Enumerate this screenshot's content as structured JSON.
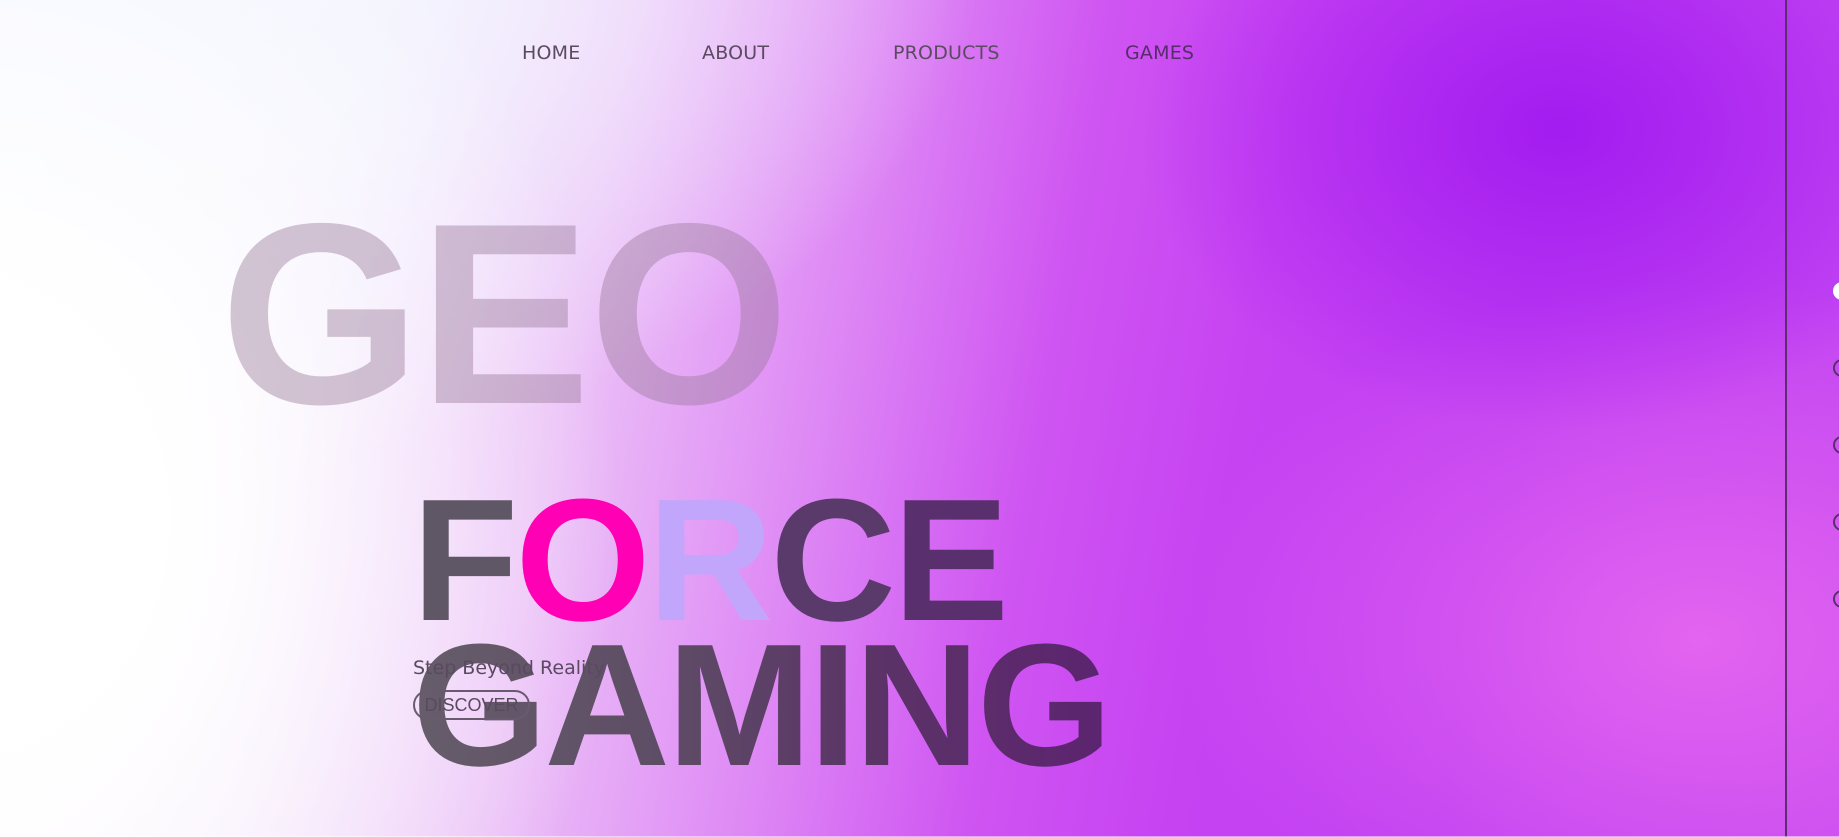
{
  "nav": {
    "items": [
      {
        "label": "HOME"
      },
      {
        "label": "ABOUT"
      },
      {
        "label": "PRODUCTS"
      },
      {
        "label": "GAMES"
      }
    ]
  },
  "hero": {
    "bg_word": "GEO",
    "title_line1_letters": [
      "F",
      "O",
      "R",
      "C",
      "E"
    ],
    "title_line2": "GAMING",
    "tagline": "Step Beyond Reality",
    "cta_label": "DISCOVER"
  },
  "pager": {
    "count": 5,
    "active_index": 0
  },
  "colors": {
    "accent_pink": "#ff00b4",
    "accent_lavender": "#c1a6fc",
    "background_purple": "#c643f2",
    "text_dark": "#5a2f6e"
  }
}
